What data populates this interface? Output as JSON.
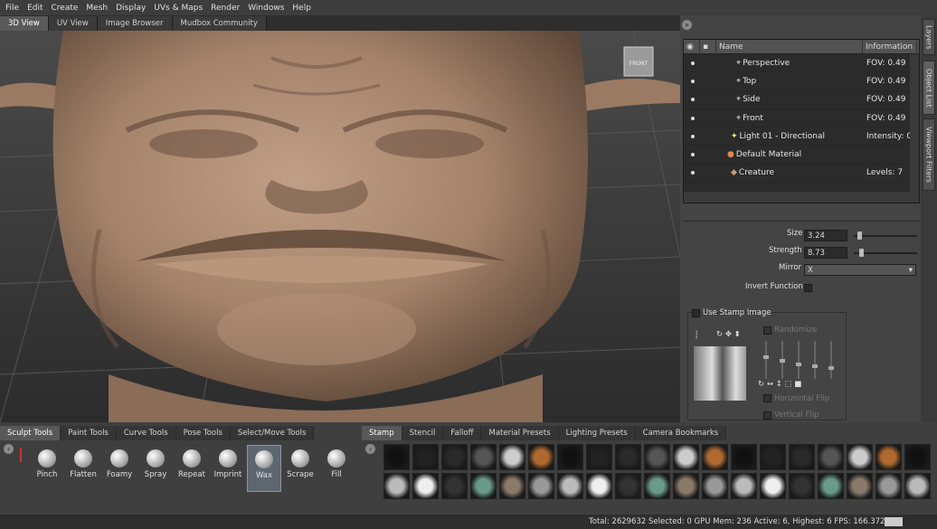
{
  "menu": [
    "File",
    "Edit",
    "Create",
    "Mesh",
    "Display",
    "UVs & Maps",
    "Render",
    "Windows",
    "Help"
  ],
  "view_tabs": [
    {
      "label": "3D View",
      "active": true
    },
    {
      "label": "UV View",
      "active": false
    },
    {
      "label": "Image Browser",
      "active": false
    },
    {
      "label": "Mudbox Community",
      "active": false
    }
  ],
  "viewport": {
    "cube_label": "FRONT"
  },
  "side_tabs": [
    "Layers",
    "Object List",
    "Viewport Filters"
  ],
  "object_list": {
    "col_name": "Name",
    "col_info": "Information",
    "rows": [
      {
        "name": "Perspective",
        "info": "FOV: 0.49",
        "icon": "camera-icon"
      },
      {
        "name": "Top",
        "info": "FOV: 0.49",
        "icon": "camera-icon"
      },
      {
        "name": "Side",
        "info": "FOV: 0.49",
        "icon": "camera-icon"
      },
      {
        "name": "Front",
        "info": "FOV: 0.49",
        "icon": "camera-icon"
      },
      {
        "name": "Light 01 - Directional",
        "info": "Intensity: 0.",
        "icon": "light-icon"
      },
      {
        "name": "Default Material",
        "info": "",
        "icon": "material-icon"
      },
      {
        "name": "Creature",
        "info": "Levels: 7",
        "icon": "mesh-icon"
      }
    ]
  },
  "properties": {
    "size_label": "Size",
    "size_value": "3.24",
    "size_level": 0.05,
    "strength_label": "Strength",
    "strength_value": "8.73",
    "strength_level": 0.08,
    "mirror_label": "Mirror",
    "mirror_value": "X",
    "invert_label": "Invert Function",
    "use_stamp_label": "Use Stamp Image",
    "randomize_label": "Randomize",
    "hflip_label": "Horizontal Flip",
    "vflip_label": "Vertical Flip"
  },
  "left_tool_tabs": [
    {
      "label": "Sculpt Tools",
      "active": true
    },
    {
      "label": "Paint Tools",
      "active": false
    },
    {
      "label": "Curve Tools",
      "active": false
    },
    {
      "label": "Pose Tools",
      "active": false
    },
    {
      "label": "Select/Move Tools",
      "active": false
    }
  ],
  "tools": [
    {
      "label": "Pinch",
      "active": false
    },
    {
      "label": "Flatten",
      "active": false
    },
    {
      "label": "Foamy",
      "active": false
    },
    {
      "label": "Spray",
      "active": false
    },
    {
      "label": "Repeat",
      "active": false
    },
    {
      "label": "Imprint",
      "active": false
    },
    {
      "label": "Wax",
      "active": true
    },
    {
      "label": "Scrape",
      "active": false
    },
    {
      "label": "Fill",
      "active": false
    }
  ],
  "right_tool_tabs": [
    {
      "label": "Stamp",
      "active": true
    },
    {
      "label": "Stencil",
      "active": false
    },
    {
      "label": "Falloff",
      "active": false
    },
    {
      "label": "Material Presets",
      "active": false
    },
    {
      "label": "Lighting Presets",
      "active": false
    },
    {
      "label": "Camera Bookmarks",
      "active": false
    }
  ],
  "status": {
    "text": "Total: 2629632  Selected: 0 GPU Mem: 236  Active: 6, Highest: 6  FPS: 166.372"
  },
  "colors": {
    "skin": "#a5836a",
    "viewport_bg": "#3a3a3a",
    "accent": "#5e6670"
  }
}
